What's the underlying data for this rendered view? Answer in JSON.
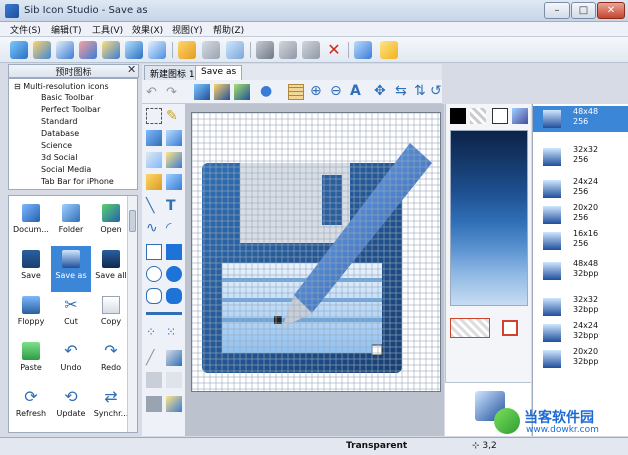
{
  "window": {
    "title": "Sib Icon Studio - Save as",
    "controls": {
      "minimize": "–",
      "maximize": "□",
      "close": "✕"
    }
  },
  "menu": [
    {
      "label": "文件(S)"
    },
    {
      "label": "编辑(T)"
    },
    {
      "label": "工具(V)"
    },
    {
      "label": "效果(X)"
    },
    {
      "label": "视图(Y)"
    },
    {
      "label": "帮助(Z)"
    }
  ],
  "left_panel": {
    "title": "预时图标",
    "close": "✕",
    "tree": [
      "Multi-resolution icons",
      "Basic Toolbar",
      "Perfect Toolbar",
      "Standard",
      "Database",
      "Science",
      "3d Social",
      "Social Media",
      "Tab Bar for iPhone"
    ],
    "grid": [
      {
        "label": "Docum...",
        "icon": "documents-icon"
      },
      {
        "label": "Folder",
        "icon": "folder-icon"
      },
      {
        "label": "Open",
        "icon": "open-icon"
      },
      {
        "label": "Save",
        "icon": "save-icon"
      },
      {
        "label": "Save as",
        "icon": "save-as-icon"
      },
      {
        "label": "Save all",
        "icon": "save-all-icon"
      },
      {
        "label": "Floppy",
        "icon": "floppy-icon"
      },
      {
        "label": "Cut",
        "icon": "cut-icon"
      },
      {
        "label": "Copy",
        "icon": "copy-icon"
      },
      {
        "label": "Paste",
        "icon": "paste-icon"
      },
      {
        "label": "Undo",
        "icon": "undo-icon"
      },
      {
        "label": "Redo",
        "icon": "redo-icon"
      },
      {
        "label": "Refresh",
        "icon": "refresh-icon"
      },
      {
        "label": "Update",
        "icon": "update-icon"
      },
      {
        "label": "Synchr...",
        "icon": "synchronize-icon"
      }
    ]
  },
  "doc_tabs": [
    {
      "label": "新建图标 1"
    },
    {
      "label": "Save as"
    }
  ],
  "size_list": [
    {
      "label": "48x48\n256",
      "selected": true
    },
    {
      "label": "32x32\n256"
    },
    {
      "label": "24x24\n256"
    },
    {
      "label": "20x20\n256"
    },
    {
      "label": "16x16\n256"
    },
    {
      "label": "48x48\n32bpp"
    },
    {
      "label": "32x32\n32bpp"
    },
    {
      "label": "24x24\n32bpp"
    },
    {
      "label": "20x20\n32bpp"
    }
  ],
  "status": {
    "text": "Transparent",
    "coords": "3,2"
  },
  "colors": {
    "accent": "#2f6fb5",
    "selection": "#3b86d7",
    "disk": "#2a5f9e"
  },
  "watermark": {
    "text": "当客软件园",
    "url": "www.dowkr.com"
  }
}
